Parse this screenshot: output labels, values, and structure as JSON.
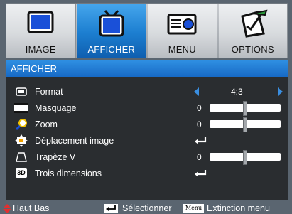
{
  "tabs": [
    {
      "label": "IMAGE",
      "icon": "monitor-icon",
      "active": false
    },
    {
      "label": "AFFICHER",
      "icon": "display-screen-icon",
      "active": true
    },
    {
      "label": "MENU",
      "icon": "projector-icon",
      "active": false
    },
    {
      "label": "OPTIONS",
      "icon": "pen-paper-icon",
      "active": false
    }
  ],
  "panel": {
    "title": "AFFICHER",
    "rows": [
      {
        "label": "Format",
        "icon": "format-icon",
        "control": "selector",
        "value": "4:3"
      },
      {
        "label": "Masquage",
        "icon": "masking-icon",
        "control": "slider",
        "value": "0",
        "level": 0.5
      },
      {
        "label": "Zoom",
        "icon": "zoom-icon",
        "control": "slider",
        "value": "0",
        "level": 0.5
      },
      {
        "label": "Déplacement image",
        "icon": "image-shift-icon",
        "control": "enter"
      },
      {
        "label": "Trapèze V",
        "icon": "keystone-icon",
        "control": "slider",
        "value": "0",
        "level": 0.5
      },
      {
        "label": "Trois dimensions",
        "icon": "3d-icon",
        "control": "enter",
        "icon_text": "3D"
      }
    ]
  },
  "footer": {
    "nav": "Haut Bas",
    "select": "Sélectionner",
    "menu_key": "Menu",
    "exit": "Extinction menu"
  },
  "colors": {
    "accent": "#1c7ed0",
    "panel_bg": "#2a2d30",
    "arrow": "#3a8ee0",
    "nav_arrow": "#e03030"
  }
}
